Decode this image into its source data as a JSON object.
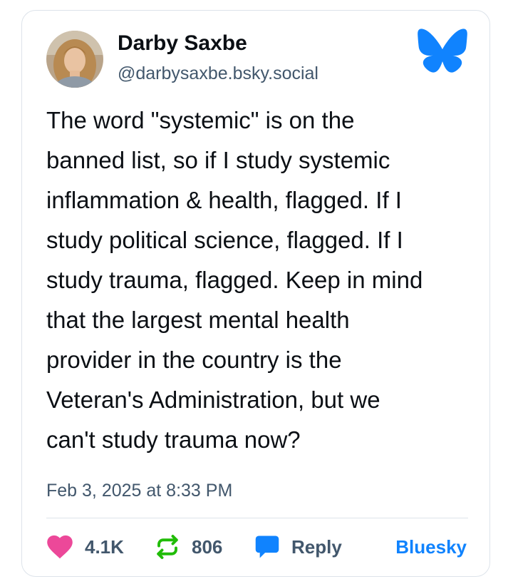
{
  "post": {
    "author": {
      "display_name": "Darby Saxbe",
      "handle": "@darbysaxbe.bsky.social"
    },
    "text_lines": [
      "The word \"systemic\" is on the",
      "banned list, so if I study systemic",
      "inflammation & health, flagged. If I",
      "study political science, flagged. If I",
      "study trauma, flagged. Keep in mind",
      "that the largest mental health",
      "provider in the country is the",
      "Veteran's Administration, but we",
      "can't study trauma now?"
    ],
    "timestamp": "Feb 3, 2025 at 8:33 PM"
  },
  "actions": {
    "likes": "4.1K",
    "reposts": "806",
    "reply_label": "Reply",
    "platform_link": "Bluesky"
  },
  "icons": {
    "logo": "bluesky-butterfly-icon",
    "like": "heart-icon",
    "repost": "repost-arrows-icon",
    "reply": "speech-bubble-icon"
  },
  "colors": {
    "brand_blue": "#1083fe",
    "like_pink": "#ec4899",
    "repost_green": "#20bc07",
    "text_primary": "#0b0f14",
    "text_secondary": "#42576c",
    "border": "#dde3ea"
  }
}
